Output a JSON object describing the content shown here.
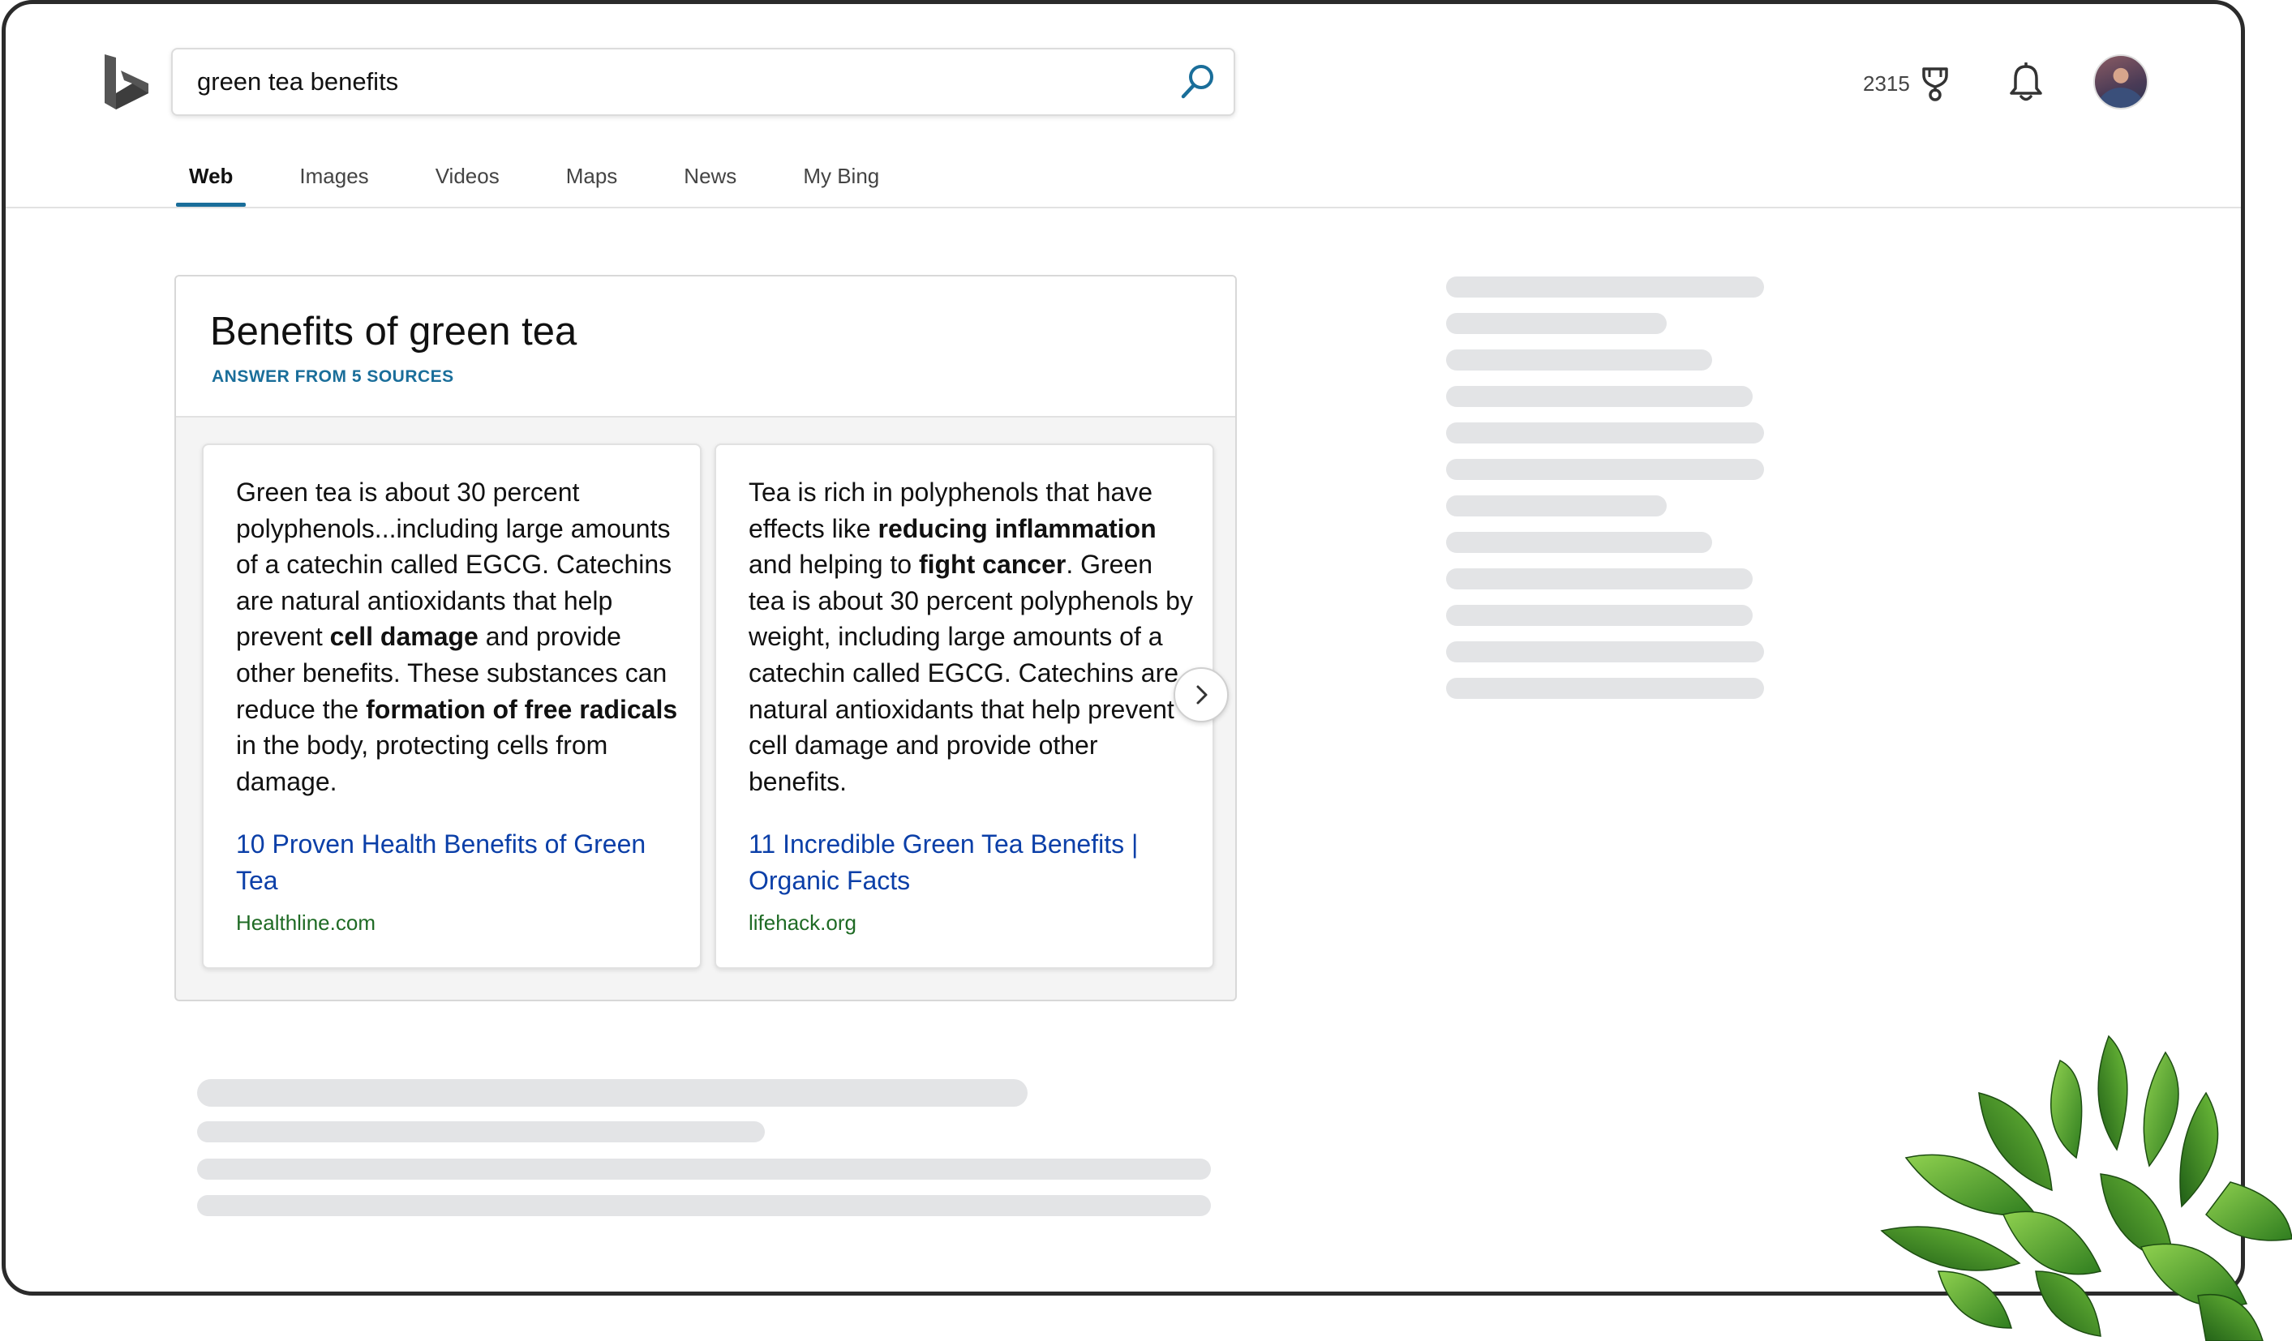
{
  "search": {
    "query": "green tea benefits"
  },
  "header": {
    "rewards_points": "2315"
  },
  "tabs": [
    {
      "label": "Web",
      "active": true
    },
    {
      "label": "Images",
      "active": false
    },
    {
      "label": "Videos",
      "active": false
    },
    {
      "label": "Maps",
      "active": false
    },
    {
      "label": "News",
      "active": false
    },
    {
      "label": "My Bing",
      "active": false
    }
  ],
  "answer": {
    "title": "Benefits of green tea",
    "subtitle": "ANSWER FROM 5 SOURCES",
    "cards": [
      {
        "text_parts": [
          {
            "text": "Green tea is about 30 percent polyphenols...including large amounts of a catechin called EGCG. Catechins are natural antioxidants that help prevent ",
            "bold": false
          },
          {
            "text": "cell damage",
            "bold": true
          },
          {
            "text": " and provide other benefits. These substances can reduce the ",
            "bold": false
          },
          {
            "text": "formation of free radicals",
            "bold": true
          },
          {
            "text": " in the body, protecting cells from damage.",
            "bold": false
          }
        ],
        "link": "10 Proven Health Benefits of Green Tea",
        "domain": "Healthline.com"
      },
      {
        "text_parts": [
          {
            "text": "Tea is rich in polyphenols that have effects like ",
            "bold": false
          },
          {
            "text": "reducing inflammation",
            "bold": true
          },
          {
            "text": " and helping to ",
            "bold": false
          },
          {
            "text": "fight cancer",
            "bold": true
          },
          {
            "text": ". Green tea is about 30 percent polyphenols by weight, including large amounts of a catechin called EGCG. Catechins are natural antioxidants that help prevent cell damage and provide other benefits.",
            "bold": false
          }
        ],
        "link": "11 Incredible Green Tea Benefits | Organic Facts",
        "domain": "lifehack.org"
      }
    ]
  },
  "icons": {
    "logo": "bing-logo-icon",
    "search": "search-icon",
    "rewards": "trophy-icon",
    "notifications": "bell-icon",
    "next": "chevron-right-icon"
  },
  "colors": {
    "accent": "#1a6e9a",
    "link": "#0b3fa8",
    "domain": "#1f6b25",
    "skeleton": "#e3e4e6",
    "frame": "#2b2b2b"
  }
}
